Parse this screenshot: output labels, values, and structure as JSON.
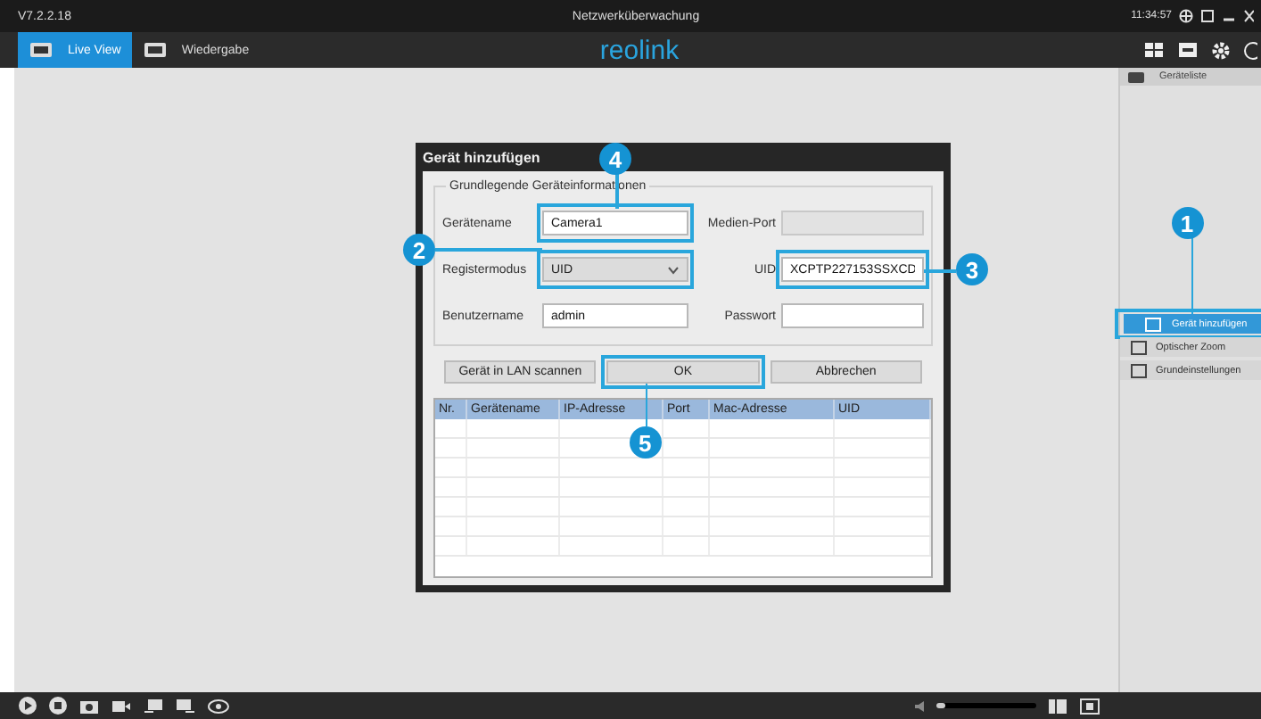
{
  "title_bar": {
    "version": "V7.2.2.18",
    "title": "Netzwerküberwachung",
    "time": "11:34:57"
  },
  "tabs": [
    {
      "label": "Live View",
      "selected": true
    },
    {
      "label": "Wiedergabe",
      "selected": false
    }
  ],
  "logo": "reolink",
  "dialog": {
    "title": "Gerät hinzufügen",
    "group_title": "Grundlegende Geräteinformationen",
    "fields": [
      {
        "label": "Gerätename",
        "value": "Camera1",
        "kind": "text",
        "callout": "4"
      },
      {
        "label": "Medien-Port",
        "kind": "text",
        "disabled": true
      },
      {
        "label": "Registermodus",
        "value": "UID",
        "kind": "select",
        "callout": "2"
      },
      {
        "label": "UID",
        "value": "XCPTP227153SSXCD",
        "kind": "text",
        "callout": "3"
      },
      {
        "label": "Benutzername",
        "value": "admin",
        "kind": "text"
      },
      {
        "label": "Passwort",
        "kind": "text"
      }
    ],
    "buttons": [
      {
        "label": "Gerät in LAN scannen"
      },
      {
        "label": "OK",
        "callout": "5"
      },
      {
        "label": "Abbrechen"
      }
    ],
    "table": {
      "columns": [
        "Nr.",
        "Gerätename",
        "IP-Adresse",
        "Port",
        "Mac-Adresse",
        "UID"
      ]
    }
  },
  "sidebar": {
    "header": "Geräteliste",
    "items": [
      {
        "label": "Gerät hinzufügen",
        "selected": true,
        "callout": "1"
      },
      {
        "label": "Optischer Zoom",
        "selected": false
      },
      {
        "label": "Grundeinstellungen",
        "selected": false
      }
    ]
  },
  "volume": {
    "level": 0.05
  }
}
